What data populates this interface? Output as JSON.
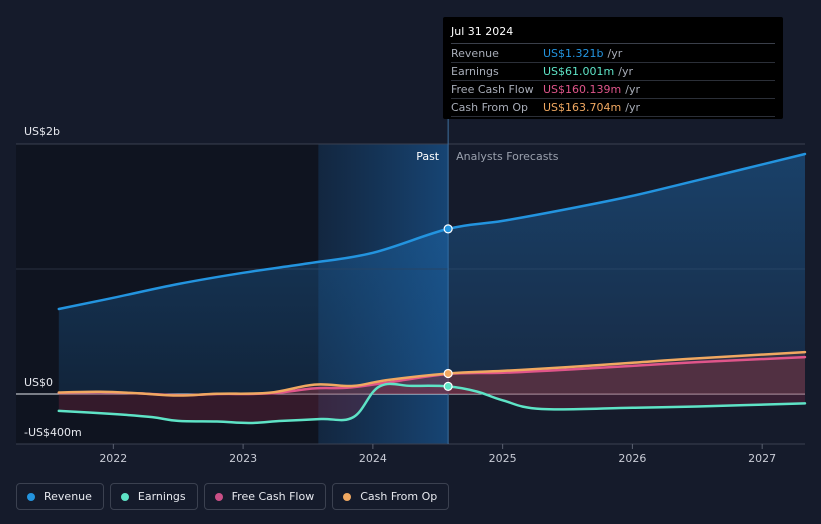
{
  "tooltip": {
    "date": "Jul 31 2024",
    "rows": [
      {
        "name": "Revenue",
        "value": "US$1.321b",
        "unit": "/yr",
        "color": "#2394df"
      },
      {
        "name": "Earnings",
        "value": "US$61.001m",
        "unit": "/yr",
        "color": "#5ee3c6"
      },
      {
        "name": "Free Cash Flow",
        "value": "US$160.139m",
        "unit": "/yr",
        "color": "#e0558a"
      },
      {
        "name": "Cash From Op",
        "value": "US$163.704m",
        "unit": "/yr",
        "color": "#f0a861"
      }
    ]
  },
  "legend": [
    {
      "label": "Revenue",
      "color": "#2394df"
    },
    {
      "label": "Earnings",
      "color": "#5ee3c6"
    },
    {
      "label": "Free Cash Flow",
      "color": "#c94f86"
    },
    {
      "label": "Cash From Op",
      "color": "#f0a861"
    }
  ],
  "chart_data": {
    "type": "line",
    "y_axis_labels": [
      {
        "text": "US$2b",
        "value": 2000
      },
      {
        "text": "US$0",
        "value": 0
      },
      {
        "text": "-US$400m",
        "value": -400
      }
    ],
    "x_ticks": [
      "2022",
      "2023",
      "2024",
      "2025",
      "2026",
      "2027"
    ],
    "region_labels": {
      "past": "Past",
      "forecast": "Analysts Forecasts"
    },
    "past_end": 2024.58,
    "highlight_start": 2023.58,
    "xlim": [
      2021.25,
      2027.33
    ],
    "ylim": [
      -400,
      2000
    ],
    "series": [
      {
        "name": "Revenue",
        "color": "#2394df",
        "points": [
          [
            2021.58,
            680
          ],
          [
            2022.0,
            770
          ],
          [
            2022.5,
            880
          ],
          [
            2023.0,
            970
          ],
          [
            2023.5,
            1045
          ],
          [
            2024.0,
            1130
          ],
          [
            2024.58,
            1321
          ],
          [
            2025.0,
            1385
          ],
          [
            2025.5,
            1480
          ],
          [
            2026.0,
            1585
          ],
          [
            2026.5,
            1710
          ],
          [
            2027.33,
            1920
          ]
        ]
      },
      {
        "name": "Earnings",
        "color": "#5ee3c6",
        "points": [
          [
            2021.58,
            -135
          ],
          [
            2022.0,
            -160
          ],
          [
            2022.3,
            -185
          ],
          [
            2022.5,
            -215
          ],
          [
            2022.8,
            -220
          ],
          [
            2023.05,
            -232
          ],
          [
            2023.3,
            -215
          ],
          [
            2023.6,
            -200
          ],
          [
            2023.85,
            -185
          ],
          [
            2024.05,
            60
          ],
          [
            2024.3,
            65
          ],
          [
            2024.58,
            61
          ],
          [
            2024.8,
            20
          ],
          [
            2025.0,
            -50
          ],
          [
            2025.3,
            -120
          ],
          [
            2026.0,
            -110
          ],
          [
            2026.5,
            -100
          ],
          [
            2027.33,
            -75
          ]
        ]
      },
      {
        "name": "Free Cash Flow",
        "color": "#e0558a",
        "points": [
          [
            2021.58,
            10
          ],
          [
            2021.9,
            15
          ],
          [
            2022.2,
            5
          ],
          [
            2022.5,
            -10
          ],
          [
            2022.8,
            0
          ],
          [
            2023.2,
            5
          ],
          [
            2023.55,
            45
          ],
          [
            2023.8,
            50
          ],
          [
            2024.1,
            90
          ],
          [
            2024.58,
            160
          ],
          [
            2025.0,
            170
          ],
          [
            2025.5,
            195
          ],
          [
            2026.0,
            225
          ],
          [
            2026.5,
            255
          ],
          [
            2027.33,
            295
          ]
        ]
      },
      {
        "name": "Cash From Op",
        "color": "#f0a861",
        "points": [
          [
            2021.58,
            12
          ],
          [
            2021.9,
            18
          ],
          [
            2022.2,
            5
          ],
          [
            2022.5,
            -12
          ],
          [
            2022.8,
            2
          ],
          [
            2023.2,
            10
          ],
          [
            2023.55,
            75
          ],
          [
            2023.85,
            65
          ],
          [
            2024.1,
            110
          ],
          [
            2024.58,
            164
          ],
          [
            2025.0,
            185
          ],
          [
            2025.5,
            215
          ],
          [
            2026.0,
            250
          ],
          [
            2026.5,
            285
          ],
          [
            2027.33,
            335
          ]
        ]
      }
    ],
    "markers": [
      {
        "series": "Revenue",
        "x": 2024.58,
        "y": 1321
      },
      {
        "series": "Earnings",
        "x": 2024.58,
        "y": 61
      },
      {
        "series": "Cash From Op",
        "x": 2024.58,
        "y": 164
      }
    ]
  }
}
